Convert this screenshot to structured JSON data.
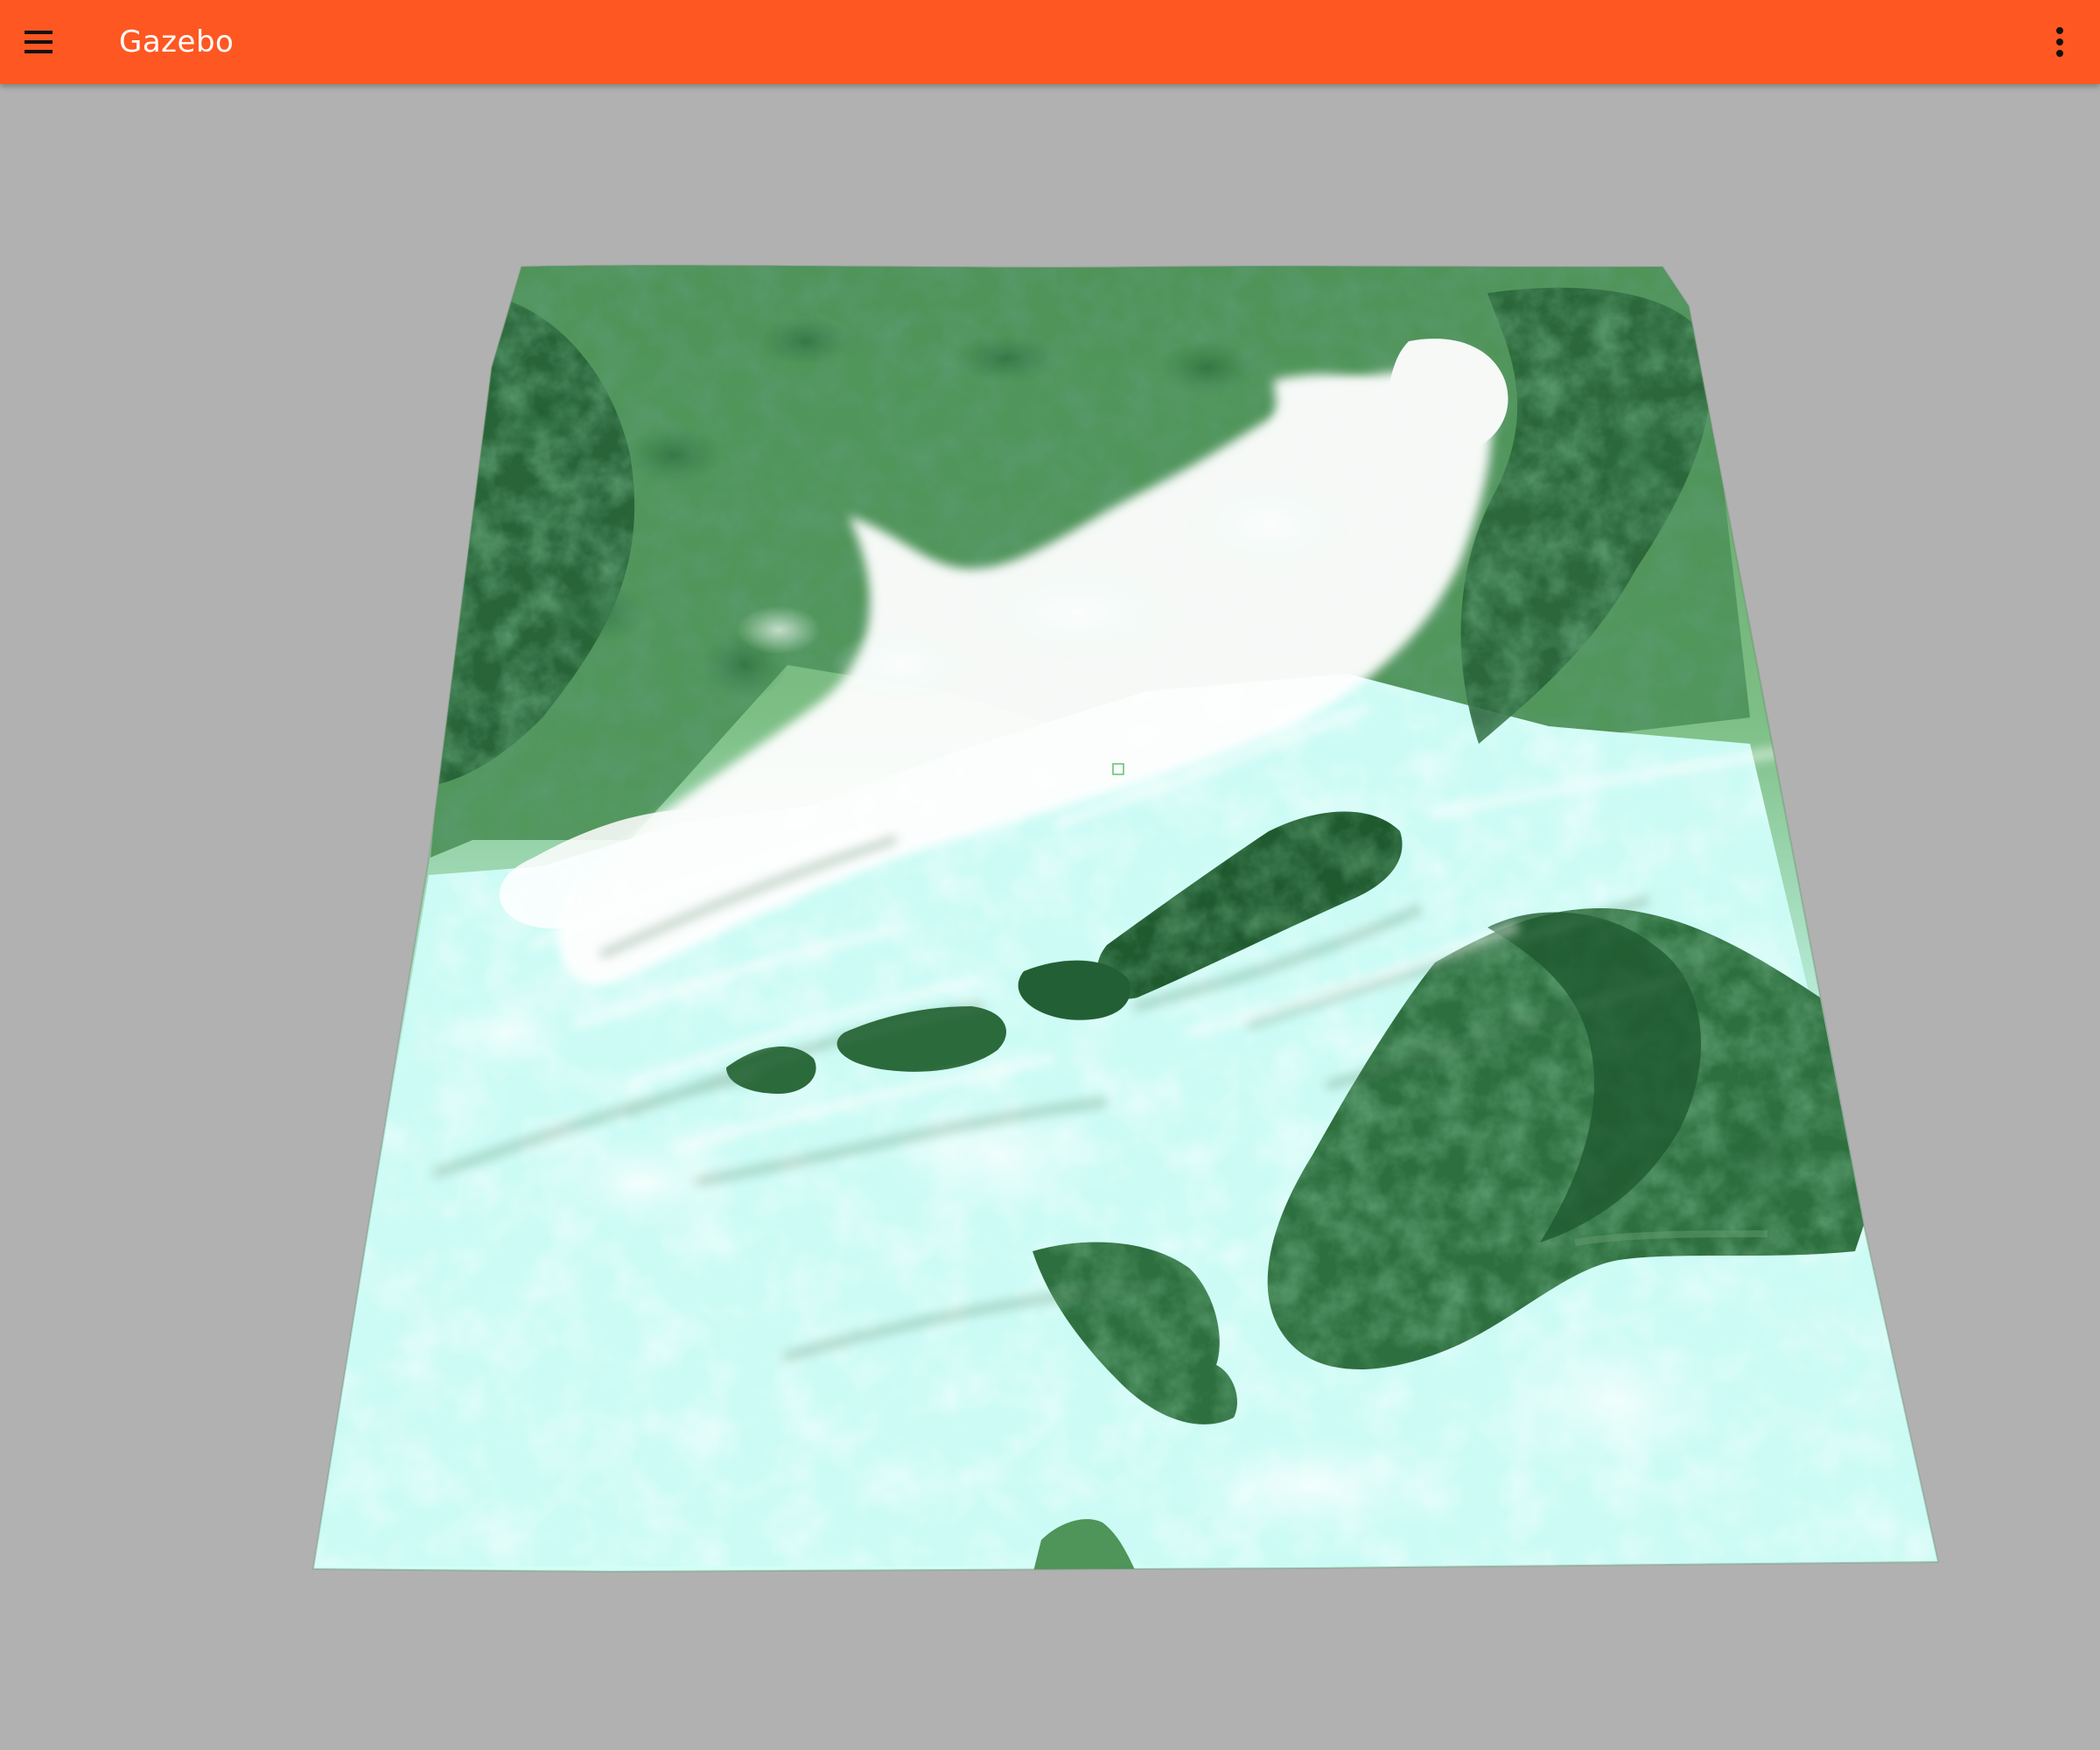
{
  "app": {
    "title": "Gazebo"
  },
  "toolbar": {
    "color": "#ff5722",
    "menu_icon": "menu-icon",
    "overflow_icon": "more-vert-icon"
  },
  "scene": {
    "background_color": "#b1b1b1",
    "terrain_light_color": "#cffcf6",
    "terrain_dark_color": "#1f5c2f"
  }
}
